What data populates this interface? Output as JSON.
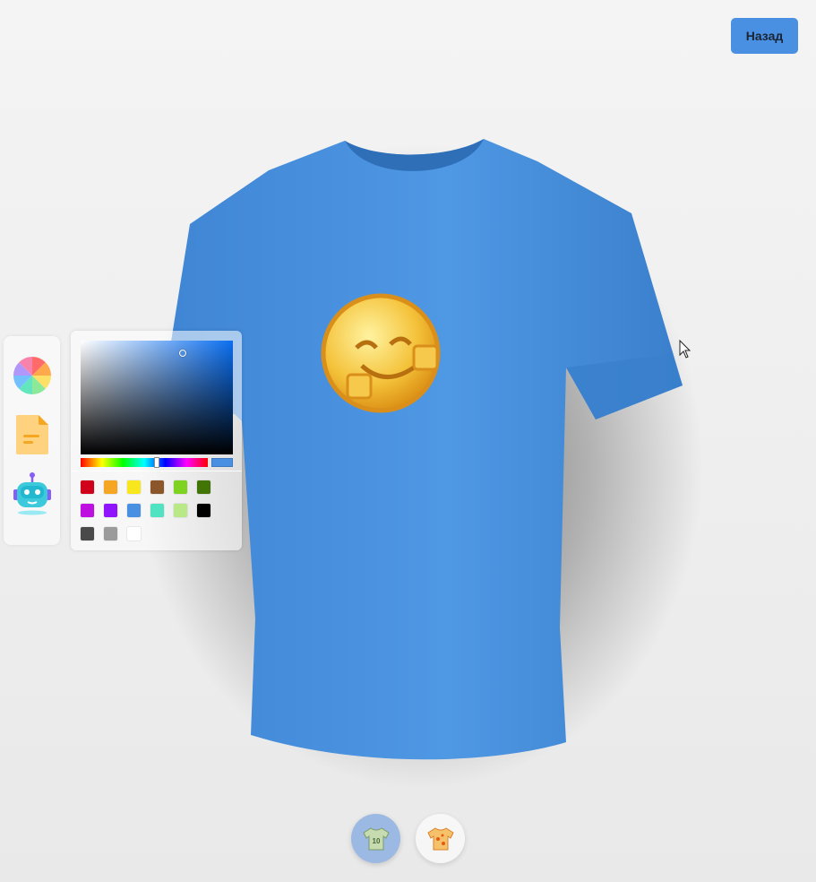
{
  "header": {
    "back_label": "Назад"
  },
  "colors": {
    "shirt": "#4a90e2",
    "accent": "#4a90e2",
    "current_color": "#4a90e2"
  },
  "sidebar": {
    "tools": [
      {
        "name": "color-wheel-icon"
      },
      {
        "name": "file-icon"
      },
      {
        "name": "robot-icon"
      }
    ]
  },
  "color_picker": {
    "selected": "#4a90e2",
    "presets": [
      "#d0021b",
      "#f5a623",
      "#f8e71c",
      "#8b572a",
      "#7ed321",
      "#417505",
      "#bd10e0",
      "#9013fe",
      "#4a90e2",
      "#50e3c2",
      "#b8e986",
      "#000000",
      "#4a4a4a",
      "#9b9b9b",
      "#ffffff"
    ]
  },
  "bottom_tabs": [
    {
      "name": "shirt-logo-tab",
      "number": "10"
    },
    {
      "name": "shirt-full-texture-tab"
    }
  ]
}
